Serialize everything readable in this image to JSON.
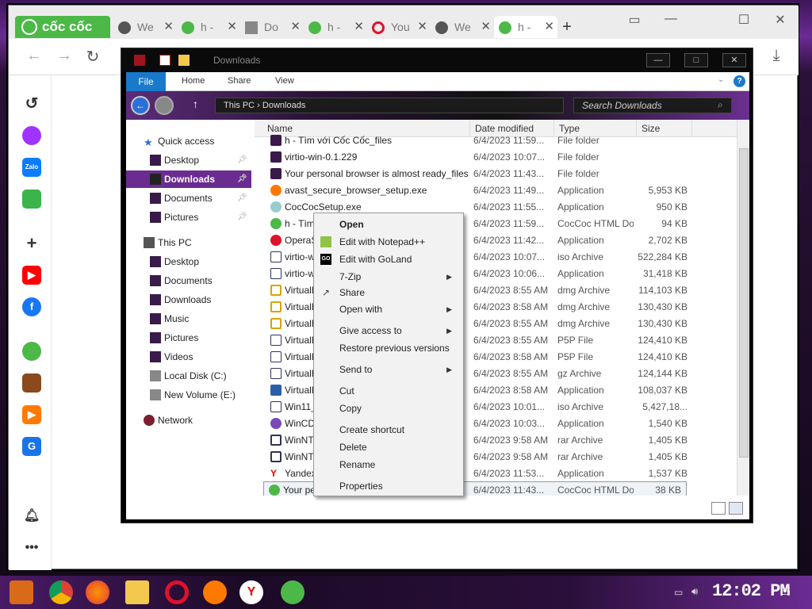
{
  "browser": {
    "brand": "cốc cốc",
    "tabs": [
      {
        "label": "We",
        "icon": "globe-icon"
      },
      {
        "label": "h -",
        "icon": "coccoc-icon"
      },
      {
        "label": "Do",
        "icon": "download-icon"
      },
      {
        "label": "h -",
        "icon": "coccoc-icon"
      },
      {
        "label": "You",
        "icon": "opera-icon"
      },
      {
        "label": "We",
        "icon": "globe-icon"
      },
      {
        "label": "h -",
        "icon": "coccoc-icon"
      }
    ],
    "new_tab": "+",
    "controls": {
      "minimize": "—",
      "maximize": "☐",
      "close": "✕"
    }
  },
  "explorer": {
    "title": "Downloads",
    "ribbon_tabs": [
      "File",
      "Home",
      "Share",
      "View"
    ],
    "breadcrumb": "This PC  ›  Downloads",
    "search_placeholder": "Search Downloads",
    "nav": {
      "quick_access": "Quick access",
      "qa_items": [
        "Desktop",
        "Downloads",
        "Documents",
        "Pictures"
      ],
      "this_pc": "This PC",
      "pc_items": [
        "Desktop",
        "Documents",
        "Downloads",
        "Music",
        "Pictures",
        "Videos",
        "Local Disk (C:)",
        "New Volume (E:)"
      ],
      "network": "Network"
    },
    "columns": {
      "name": "Name",
      "date": "Date modified",
      "type": "Type",
      "size": "Size"
    },
    "files": [
      {
        "name": "h - Tìm với Cốc Cốc_files",
        "date": "6/4/2023 11:59...",
        "type": "File folder",
        "size": ""
      },
      {
        "name": "virtio-win-0.1.229",
        "date": "6/4/2023 10:07...",
        "type": "File folder",
        "size": ""
      },
      {
        "name": "Your personal browser is almost ready_files",
        "date": "6/4/2023 11:43...",
        "type": "File folder",
        "size": ""
      },
      {
        "name": "avast_secure_browser_setup.exe",
        "date": "6/4/2023 11:49...",
        "type": "Application",
        "size": "5,953 KB"
      },
      {
        "name": "CocCocSetup.exe",
        "date": "6/4/2023 11:55...",
        "type": "Application",
        "size": "950 KB"
      },
      {
        "name": "h - Tìm",
        "date": "6/4/2023 11:59...",
        "type": "CocCoc HTML Do...",
        "size": "94 KB"
      },
      {
        "name": "OperaS",
        "date": "6/4/2023 11:42...",
        "type": "Application",
        "size": "2,702 KB"
      },
      {
        "name": "virtio-wi",
        "date": "6/4/2023 10:07...",
        "type": "iso Archive",
        "size": "522,284 KB"
      },
      {
        "name": "virtio-wi",
        "date": "6/4/2023 10:06...",
        "type": "Application",
        "size": "31,418 KB"
      },
      {
        "name": "VirtualB",
        "date": "6/4/2023 8:55 AM",
        "type": "dmg Archive",
        "size": "114,103 KB"
      },
      {
        "name": "VirtualB",
        "date": "6/4/2023 8:58 AM",
        "type": "dmg Archive",
        "size": "130,430 KB"
      },
      {
        "name": "VirtualB",
        "date": "6/4/2023 8:55 AM",
        "type": "dmg Archive",
        "size": "130,430 KB"
      },
      {
        "name": "VirtualB",
        "date": "6/4/2023 8:55 AM",
        "type": "P5P File",
        "size": "124,410 KB"
      },
      {
        "name": "VirtualB",
        "date": "6/4/2023 8:58 AM",
        "type": "P5P File",
        "size": "124,410 KB"
      },
      {
        "name": "VirtualB",
        "date": "6/4/2023 8:55 AM",
        "type": "gz Archive",
        "size": "124,144 KB"
      },
      {
        "name": "VirtualB",
        "date": "6/4/2023 8:58 AM",
        "type": "Application",
        "size": "108,037 KB"
      },
      {
        "name": "Win11_2",
        "date": "6/4/2023 10:01...",
        "type": "iso Archive",
        "size": "5,427,18..."
      },
      {
        "name": "WinCDEr",
        "date": "6/4/2023 10:03...",
        "type": "Application",
        "size": "1,540 KB"
      },
      {
        "name": "WinNTSe",
        "date": "6/4/2023 9:58 AM",
        "type": "rar Archive",
        "size": "1,405 KB"
      },
      {
        "name": "WinNTSe",
        "date": "6/4/2023 9:58 AM",
        "type": "rar Archive",
        "size": "1,405 KB"
      },
      {
        "name": "Yandex",
        "date": "6/4/2023 11:53...",
        "type": "Application",
        "size": "1,537 KB"
      },
      {
        "name": "Your pe",
        "date": "6/4/2023 11:43...",
        "type": "CocCoc HTML Do...",
        "size": "38 KB"
      }
    ]
  },
  "context_menu": [
    {
      "label": "Open",
      "bold": true
    },
    {
      "label": "Edit with Notepad++",
      "icon": "notepadpp-icon"
    },
    {
      "label": "Edit with GoLand",
      "icon": "goland-icon"
    },
    {
      "label": "7-Zip",
      "submenu": true
    },
    {
      "label": "Share",
      "icon": "share-icon"
    },
    {
      "label": "Open with",
      "submenu": true
    },
    {
      "label": "Give access to",
      "submenu": true
    },
    {
      "label": "Restore previous versions"
    },
    {
      "label": "Send to",
      "submenu": true
    },
    {
      "label": "Cut"
    },
    {
      "label": "Copy"
    },
    {
      "label": "Create shortcut"
    },
    {
      "label": "Delete"
    },
    {
      "label": "Rename"
    },
    {
      "label": "Properties"
    }
  ],
  "taskbar": {
    "clock": "12:02 PM"
  }
}
